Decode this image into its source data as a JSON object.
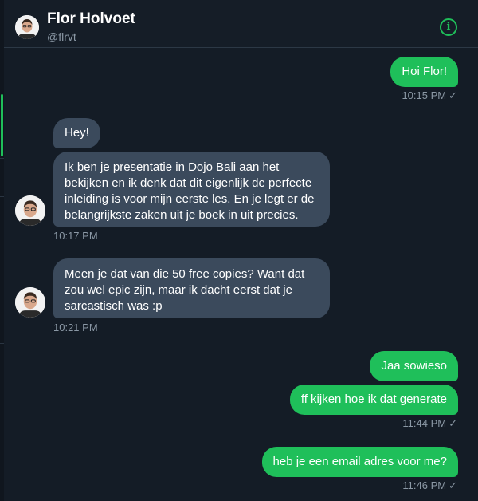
{
  "header": {
    "name": "Flor Holvoet",
    "handle": "@flrvt",
    "info_icon": "info-icon"
  },
  "colors": {
    "accent": "#1fbf5a",
    "background": "#141c26",
    "incoming_bubble": "#3b4a5c",
    "timestamp": "#8b98a5"
  },
  "messages": [
    {
      "direction": "out",
      "text": "Hoi Flor!",
      "time": "10:15 PM",
      "read_check": "✓"
    },
    {
      "direction": "in",
      "text": "Hey!"
    },
    {
      "direction": "in",
      "text": "Ik ben je presentatie in Dojo Bali aan het bekijken en ik denk dat dit eigenlijk de perfecte inleiding is voor mijn eerste les. En je legt er de belangrijkste zaken uit je boek in uit precies.",
      "time": "10:17 PM"
    },
    {
      "direction": "in",
      "text": "Meen je dat van die 50 free copies? Want dat zou wel epic zijn, maar ik dacht eerst dat je sarcastisch was :p",
      "time": "10:21 PM"
    },
    {
      "direction": "out",
      "text": "Jaa sowieso"
    },
    {
      "direction": "out",
      "text": "ff kijken hoe ik dat generate",
      "time": "11:44 PM",
      "read_check": "✓"
    },
    {
      "direction": "out",
      "text": "heb je een email adres voor me?",
      "time": "11:46 PM",
      "read_check": "✓"
    }
  ]
}
